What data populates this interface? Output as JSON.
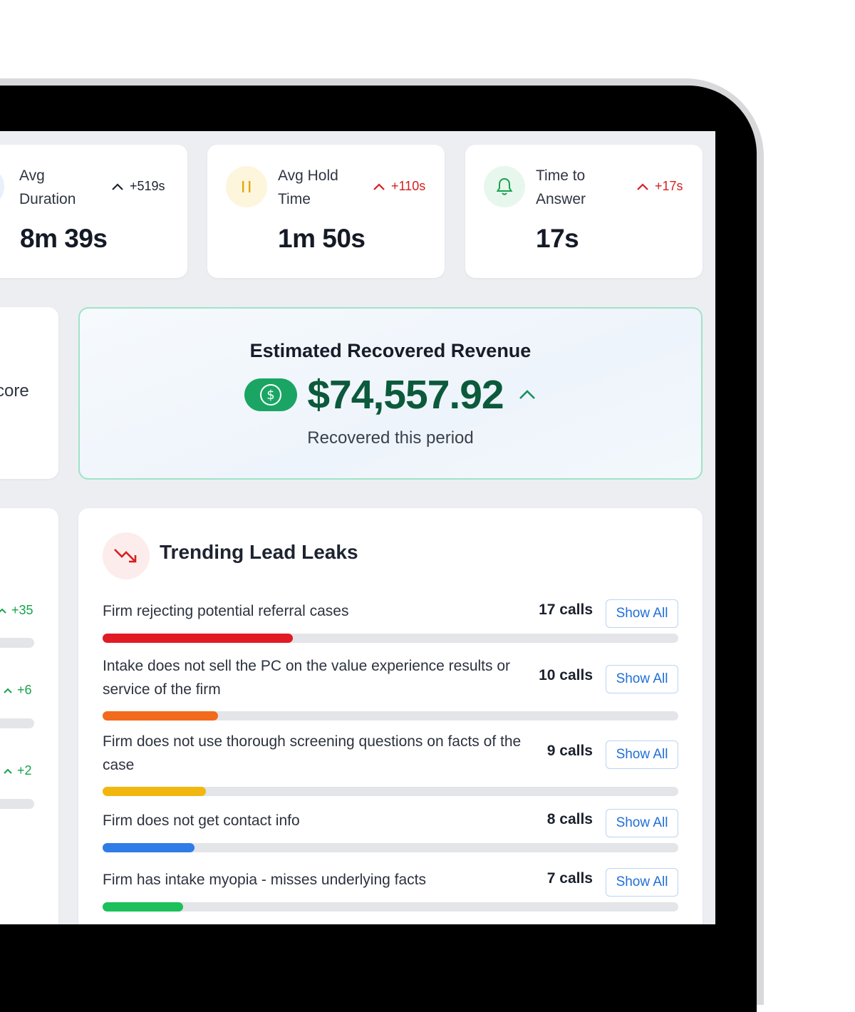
{
  "stats": [
    {
      "label_line1": "Avg",
      "label_line2": "Duration",
      "value": "8m 39s",
      "delta": "+519s",
      "delta_color": "#1d2330",
      "icon": "clock-icon"
    },
    {
      "label_line1": "Avg Hold",
      "label_line2": "Time",
      "value": "1m 50s",
      "delta": "+110s",
      "delta_color": "#d61f1f",
      "icon": "pause-icon"
    },
    {
      "label_line1": "Time to",
      "label_line2": "Answer",
      "value": "17s",
      "delta": "+17s",
      "delta_color": "#d61f1f",
      "icon": "bell-icon"
    }
  ],
  "left_card": {
    "partial_label": "core"
  },
  "left_list": {
    "deltas": [
      "+35",
      "+6",
      "+2"
    ]
  },
  "revenue": {
    "title": "Estimated Recovered Revenue",
    "amount": "$74,557.92",
    "subtitle": "Recovered this period",
    "icon": "dollar-icon",
    "accent": "#1aa564"
  },
  "leaks": {
    "title": "Trending Lead Leaks",
    "icon": "trending-down-icon",
    "button_label": "Show All",
    "items": [
      {
        "text": "Firm rejecting potential referral cases",
        "calls": "17 calls",
        "progress": 0.33,
        "color": "#e01b24"
      },
      {
        "text": "Intake does not sell the PC on the value experience results or service of the firm",
        "calls": "10 calls",
        "progress": 0.2,
        "color": "#f26a1b"
      },
      {
        "text": "Firm does not use thorough screening questions on facts of the case",
        "calls": "9 calls",
        "progress": 0.18,
        "color": "#f2b70f"
      },
      {
        "text": "Firm does not get contact info",
        "calls": "8 calls",
        "progress": 0.16,
        "color": "#2f7be8"
      },
      {
        "text": "Firm has intake myopia - misses underlying facts",
        "calls": "7 calls",
        "progress": 0.14,
        "color": "#1cc05a"
      }
    ]
  }
}
